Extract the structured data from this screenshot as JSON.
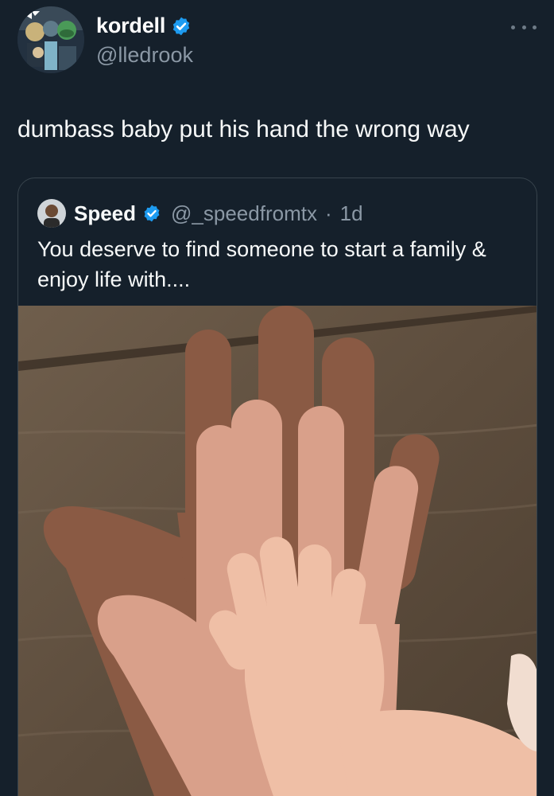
{
  "tweet": {
    "author_name": "kordell",
    "author_handle": "@lledrook",
    "text": "dumbass baby put his hand the wrong way",
    "verified": true
  },
  "quoted": {
    "author_name": "Speed",
    "author_handle": "@_speedfromtx",
    "separator": "·",
    "time": "1d",
    "text": "You deserve to find someone to start a family & enjoy life with....",
    "verified": true
  },
  "icons": {
    "more": "more-horizontal-icon",
    "verified": "verified-badge-icon"
  },
  "colors": {
    "background": "#15202b",
    "text_primary": "#f7f9f9",
    "text_secondary": "#8b98a5",
    "verified": "#1d9bf0",
    "border": "#38444d"
  }
}
